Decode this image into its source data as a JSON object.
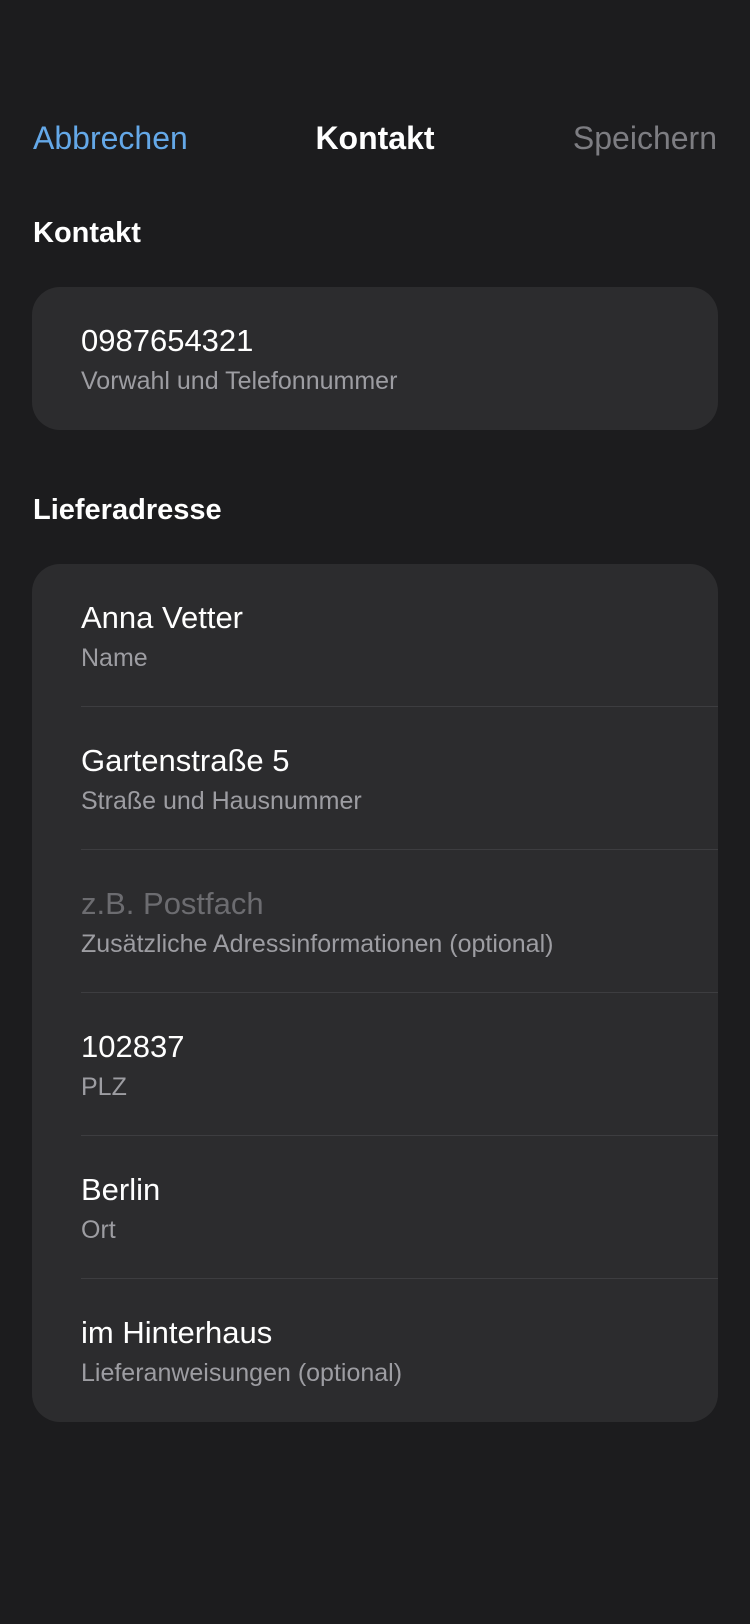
{
  "nav": {
    "cancel_label": "Abbrechen",
    "title": "Kontakt",
    "save_label": "Speichern"
  },
  "contact_section": {
    "header": "Kontakt",
    "fields": [
      {
        "value": "0987654321",
        "placeholder": "",
        "label": "Vorwahl und Telefonnummer"
      }
    ]
  },
  "address_section": {
    "header": "Lieferadresse",
    "fields": [
      {
        "value": "Anna Vetter",
        "placeholder": "",
        "label": "Name"
      },
      {
        "value": "Gartenstraße 5",
        "placeholder": "",
        "label": "Straße und Hausnummer"
      },
      {
        "value": "",
        "placeholder": "z.B. Postfach",
        "label": "Zusätzliche Adressinformationen (optional)"
      },
      {
        "value": "102837",
        "placeholder": "",
        "label": "PLZ"
      },
      {
        "value": "Berlin",
        "placeholder": "",
        "label": "Ort"
      },
      {
        "value": "im Hinterhaus",
        "placeholder": "",
        "label": "Lieferanweisungen (optional)"
      }
    ]
  },
  "colors": {
    "background": "#1c1c1e",
    "card": "#2c2c2e",
    "accent": "#64a8e8",
    "disabled": "#7d7d82"
  }
}
